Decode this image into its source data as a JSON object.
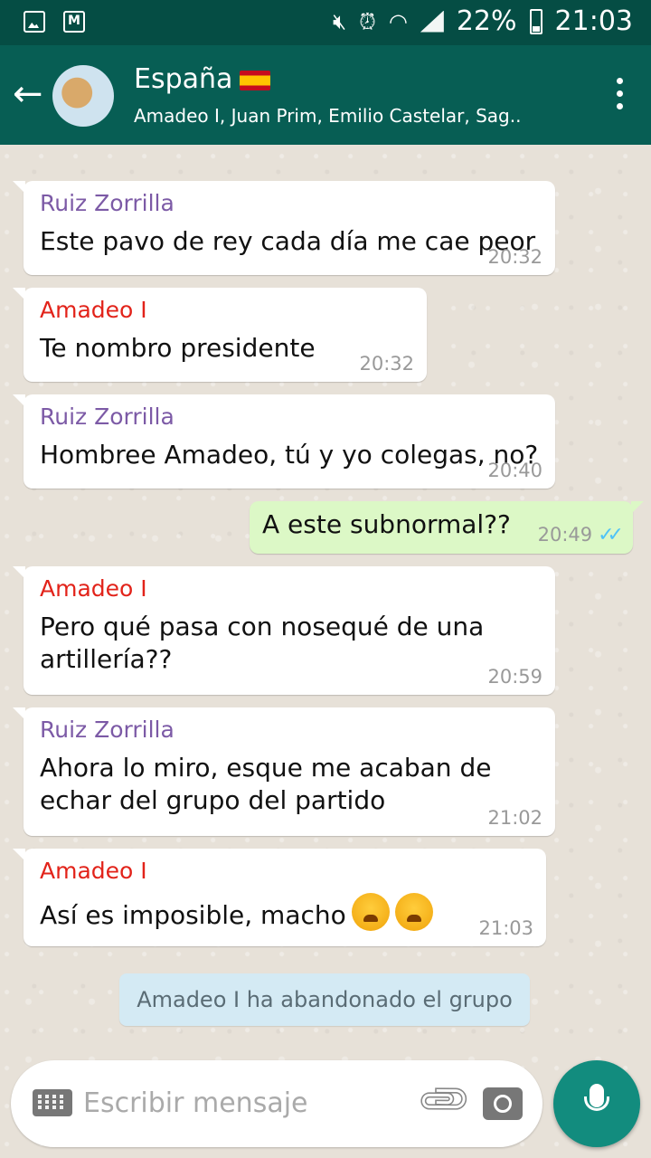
{
  "status_bar": {
    "battery_percent": "22%",
    "time": "21:03",
    "icons": [
      "gallery-icon",
      "gmail-icon",
      "mute-icon",
      "alarm-icon",
      "wifi-icon",
      "signal-icon",
      "battery-icon"
    ]
  },
  "header": {
    "title": "España",
    "subtitle": "Amadeo I, Juan Prim, Emilio Castelar, Sag..",
    "colors": {
      "appbar": "#075e54",
      "statusbar": "#054d44"
    }
  },
  "messages": [
    {
      "sender": "Ruiz Zorrilla",
      "sender_color": "#7c5aa6",
      "text": "Este pavo de rey cada día me cae peor",
      "time": "20:32",
      "direction": "in"
    },
    {
      "sender": "Amadeo I",
      "sender_color": "#e2231a",
      "text": "Te nombro presidente",
      "time": "20:32",
      "direction": "in"
    },
    {
      "sender": "Ruiz Zorrilla",
      "sender_color": "#7c5aa6",
      "text": "Hombree Amadeo, tú y yo colegas, no?",
      "time": "20:40",
      "direction": "in"
    },
    {
      "text": "A este subnormal??",
      "time": "20:49",
      "direction": "out",
      "status": "read"
    },
    {
      "sender": "Amadeo I",
      "sender_color": "#e2231a",
      "text": "Pero qué pasa con nosequé de una artillería??",
      "time": "20:59",
      "direction": "in"
    },
    {
      "sender": "Ruiz Zorrilla",
      "sender_color": "#7c5aa6",
      "text": "Ahora lo miro, esque me acaban de echar del grupo del partido",
      "time": "21:02",
      "direction": "in"
    },
    {
      "sender": "Amadeo I",
      "sender_color": "#e2231a",
      "text": "Así es imposible, macho",
      "time": "21:03",
      "direction": "in",
      "emojis": [
        "weary-face",
        "face-with-steam"
      ]
    }
  ],
  "system_message": "Amadeo I ha abandonado el grupo",
  "composer": {
    "placeholder": "Escribir mensaje"
  }
}
